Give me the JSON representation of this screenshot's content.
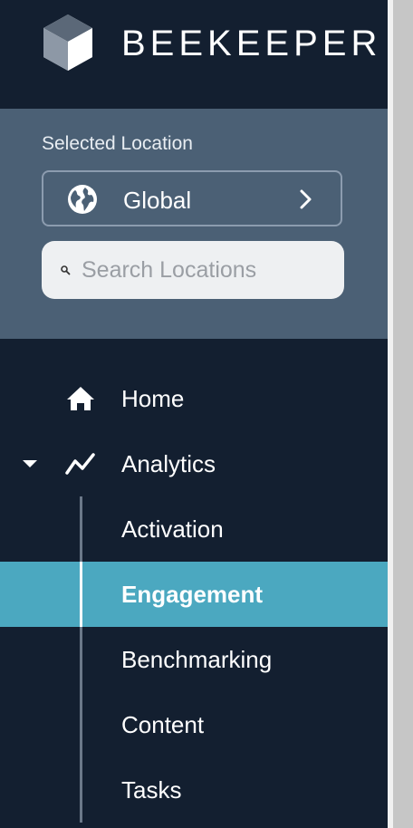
{
  "app": {
    "brand": "BEEKEEPER"
  },
  "location": {
    "label": "Selected Location",
    "selected": "Global",
    "search_placeholder": "Search Locations"
  },
  "nav": {
    "home": "Home",
    "analytics": "Analytics",
    "analytics_children": [
      "Activation",
      "Engagement",
      "Benchmarking",
      "Content",
      "Tasks"
    ],
    "active_item": "Engagement"
  },
  "colors": {
    "sidebar_bg": "#131f30",
    "location_panel_bg": "#4b6075",
    "active_bg": "#4ba8c0"
  },
  "icons": {
    "logo": "beekeeper-logo-icon",
    "globe": "globe-icon",
    "chevron": "chevron-right-icon",
    "search": "search-icon",
    "home": "home-icon",
    "analytics": "trend-line-icon",
    "caret": "caret-down-icon"
  }
}
